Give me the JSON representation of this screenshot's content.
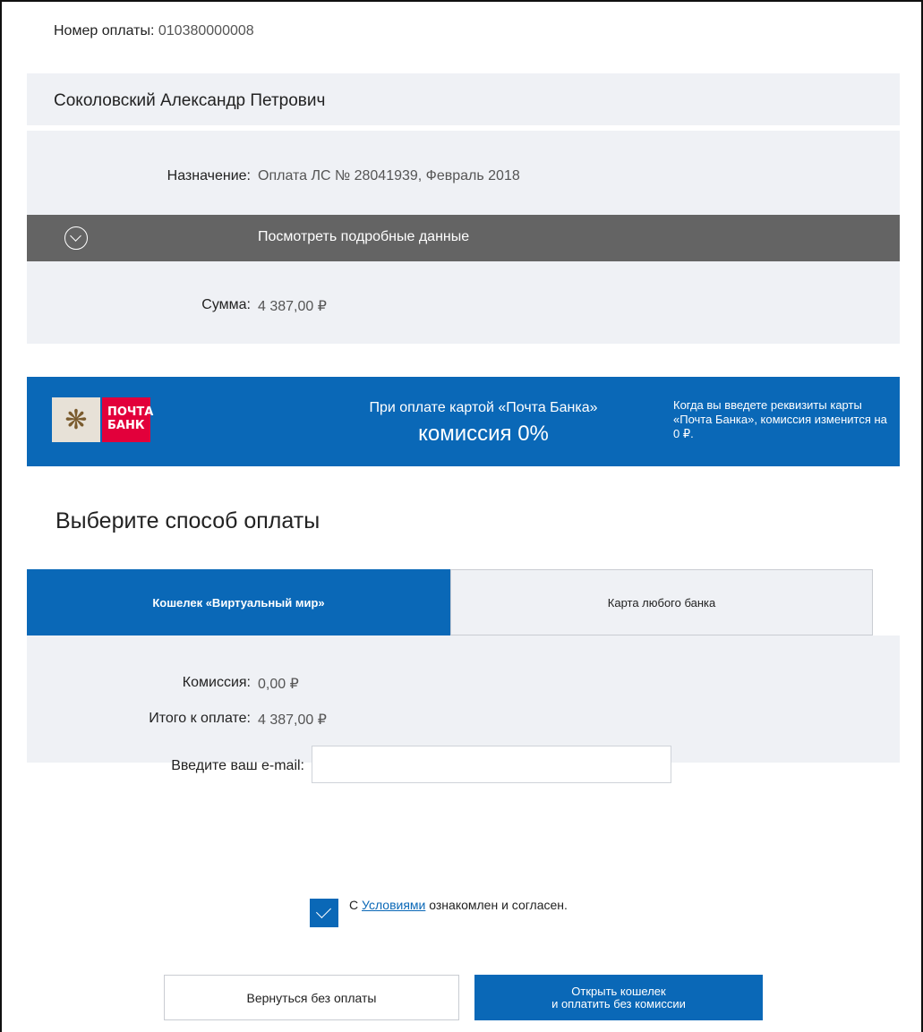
{
  "payment": {
    "number_label": "Номер оплаты:",
    "number_value": "010380000008",
    "payer_name": "Соколовский Александр Петрович",
    "purpose_label": "Назначение:",
    "purpose_value": "Оплата ЛС № 28041939, Февраль 2018",
    "details_label": "Посмотреть подробные данные",
    "sum_label": "Сумма:",
    "sum_value": "4 387,00 ₽"
  },
  "banner": {
    "logo_text_line1": "ПОЧТА",
    "logo_text_line2": "БАНК",
    "line1": "При оплате картой «Почта Банка»",
    "line2": "комиссия 0%",
    "note": "Когда вы введете реквизиты карты «Почта Банка», комиссия изменится на 0 ₽.",
    "color": "#0a68b7"
  },
  "method": {
    "title": "Выберите способ оплаты",
    "tabs": [
      {
        "label": "Кошелек «Виртуальный мир»",
        "active": true
      },
      {
        "label": "Карта любого банка",
        "active": false
      }
    ],
    "commission_label": "Комиссия:",
    "commission_value": "0,00 ₽",
    "total_label": "Итого к оплате:",
    "total_value": "4 387,00 ₽"
  },
  "form": {
    "email_label": "Введите ваш e-mail:",
    "email_value": "",
    "agree_prefix": "С ",
    "agree_link": "Условиями",
    "agree_suffix": " ознакомлен и согласен.",
    "agree_checked": true
  },
  "buttons": {
    "back_label": "Вернуться без оплаты",
    "open_line1": "Открыть кошелек",
    "open_line2": "и оплатить без комиссии"
  }
}
